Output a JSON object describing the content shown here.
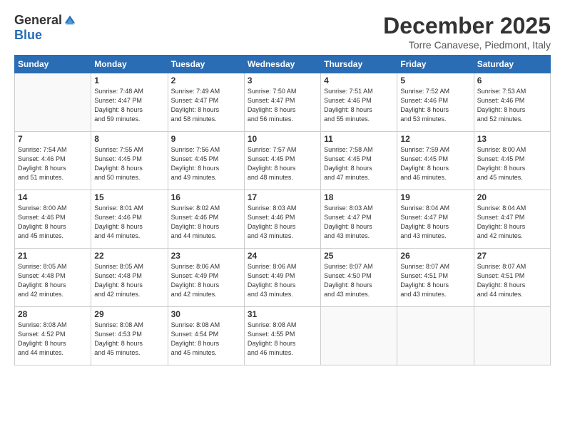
{
  "logo": {
    "general": "General",
    "blue": "Blue"
  },
  "title": "December 2025",
  "location": "Torre Canavese, Piedmont, Italy",
  "days_of_week": [
    "Sunday",
    "Monday",
    "Tuesday",
    "Wednesday",
    "Thursday",
    "Friday",
    "Saturday"
  ],
  "weeks": [
    [
      {
        "day": "",
        "info": ""
      },
      {
        "day": "1",
        "info": "Sunrise: 7:48 AM\nSunset: 4:47 PM\nDaylight: 8 hours\nand 59 minutes."
      },
      {
        "day": "2",
        "info": "Sunrise: 7:49 AM\nSunset: 4:47 PM\nDaylight: 8 hours\nand 58 minutes."
      },
      {
        "day": "3",
        "info": "Sunrise: 7:50 AM\nSunset: 4:47 PM\nDaylight: 8 hours\nand 56 minutes."
      },
      {
        "day": "4",
        "info": "Sunrise: 7:51 AM\nSunset: 4:46 PM\nDaylight: 8 hours\nand 55 minutes."
      },
      {
        "day": "5",
        "info": "Sunrise: 7:52 AM\nSunset: 4:46 PM\nDaylight: 8 hours\nand 53 minutes."
      },
      {
        "day": "6",
        "info": "Sunrise: 7:53 AM\nSunset: 4:46 PM\nDaylight: 8 hours\nand 52 minutes."
      }
    ],
    [
      {
        "day": "7",
        "info": "Sunrise: 7:54 AM\nSunset: 4:46 PM\nDaylight: 8 hours\nand 51 minutes."
      },
      {
        "day": "8",
        "info": "Sunrise: 7:55 AM\nSunset: 4:45 PM\nDaylight: 8 hours\nand 50 minutes."
      },
      {
        "day": "9",
        "info": "Sunrise: 7:56 AM\nSunset: 4:45 PM\nDaylight: 8 hours\nand 49 minutes."
      },
      {
        "day": "10",
        "info": "Sunrise: 7:57 AM\nSunset: 4:45 PM\nDaylight: 8 hours\nand 48 minutes."
      },
      {
        "day": "11",
        "info": "Sunrise: 7:58 AM\nSunset: 4:45 PM\nDaylight: 8 hours\nand 47 minutes."
      },
      {
        "day": "12",
        "info": "Sunrise: 7:59 AM\nSunset: 4:45 PM\nDaylight: 8 hours\nand 46 minutes."
      },
      {
        "day": "13",
        "info": "Sunrise: 8:00 AM\nSunset: 4:45 PM\nDaylight: 8 hours\nand 45 minutes."
      }
    ],
    [
      {
        "day": "14",
        "info": "Sunrise: 8:00 AM\nSunset: 4:46 PM\nDaylight: 8 hours\nand 45 minutes."
      },
      {
        "day": "15",
        "info": "Sunrise: 8:01 AM\nSunset: 4:46 PM\nDaylight: 8 hours\nand 44 minutes."
      },
      {
        "day": "16",
        "info": "Sunrise: 8:02 AM\nSunset: 4:46 PM\nDaylight: 8 hours\nand 44 minutes."
      },
      {
        "day": "17",
        "info": "Sunrise: 8:03 AM\nSunset: 4:46 PM\nDaylight: 8 hours\nand 43 minutes."
      },
      {
        "day": "18",
        "info": "Sunrise: 8:03 AM\nSunset: 4:47 PM\nDaylight: 8 hours\nand 43 minutes."
      },
      {
        "day": "19",
        "info": "Sunrise: 8:04 AM\nSunset: 4:47 PM\nDaylight: 8 hours\nand 43 minutes."
      },
      {
        "day": "20",
        "info": "Sunrise: 8:04 AM\nSunset: 4:47 PM\nDaylight: 8 hours\nand 42 minutes."
      }
    ],
    [
      {
        "day": "21",
        "info": "Sunrise: 8:05 AM\nSunset: 4:48 PM\nDaylight: 8 hours\nand 42 minutes."
      },
      {
        "day": "22",
        "info": "Sunrise: 8:05 AM\nSunset: 4:48 PM\nDaylight: 8 hours\nand 42 minutes."
      },
      {
        "day": "23",
        "info": "Sunrise: 8:06 AM\nSunset: 4:49 PM\nDaylight: 8 hours\nand 42 minutes."
      },
      {
        "day": "24",
        "info": "Sunrise: 8:06 AM\nSunset: 4:49 PM\nDaylight: 8 hours\nand 43 minutes."
      },
      {
        "day": "25",
        "info": "Sunrise: 8:07 AM\nSunset: 4:50 PM\nDaylight: 8 hours\nand 43 minutes."
      },
      {
        "day": "26",
        "info": "Sunrise: 8:07 AM\nSunset: 4:51 PM\nDaylight: 8 hours\nand 43 minutes."
      },
      {
        "day": "27",
        "info": "Sunrise: 8:07 AM\nSunset: 4:51 PM\nDaylight: 8 hours\nand 44 minutes."
      }
    ],
    [
      {
        "day": "28",
        "info": "Sunrise: 8:08 AM\nSunset: 4:52 PM\nDaylight: 8 hours\nand 44 minutes."
      },
      {
        "day": "29",
        "info": "Sunrise: 8:08 AM\nSunset: 4:53 PM\nDaylight: 8 hours\nand 45 minutes."
      },
      {
        "day": "30",
        "info": "Sunrise: 8:08 AM\nSunset: 4:54 PM\nDaylight: 8 hours\nand 45 minutes."
      },
      {
        "day": "31",
        "info": "Sunrise: 8:08 AM\nSunset: 4:55 PM\nDaylight: 8 hours\nand 46 minutes."
      },
      {
        "day": "",
        "info": ""
      },
      {
        "day": "",
        "info": ""
      },
      {
        "day": "",
        "info": ""
      }
    ]
  ]
}
